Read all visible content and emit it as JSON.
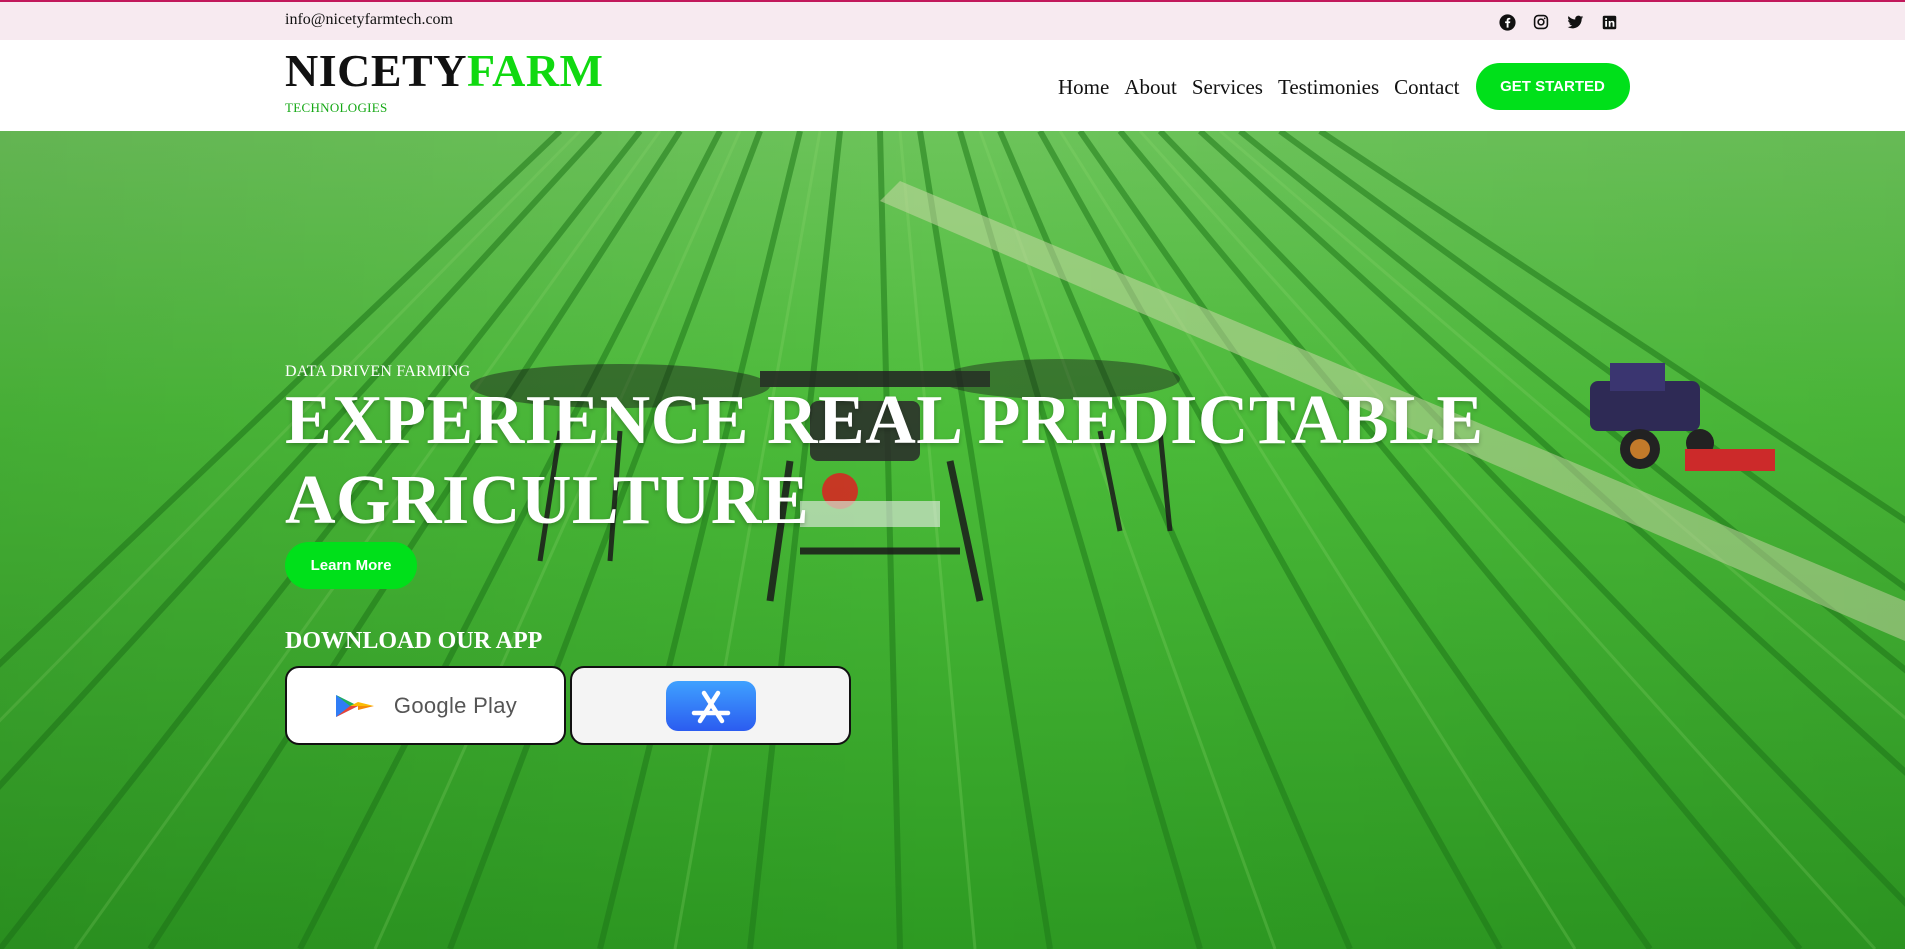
{
  "topbar": {
    "email": "info@nicetyfarmtech.com",
    "social": [
      "facebook-icon",
      "instagram-icon",
      "twitter-icon",
      "linkedin-icon"
    ]
  },
  "header": {
    "brand_part1": "NICETY",
    "brand_part2": "FARM",
    "brand_sub": "TECHNOLOGIES",
    "nav": [
      "Home",
      "About",
      "Services",
      "Testimonies",
      "Contact"
    ],
    "cta": "GET STARTED"
  },
  "hero": {
    "eyebrow": "DATA DRIVEN FARMING",
    "title": "EXPERIENCE REAL PREDICTABLE AGRICULTURE",
    "learn_more": "Learn More",
    "download_heading": "DOWNLOAD OUR APP",
    "google_play_label": "Google Play"
  },
  "colors": {
    "accent_green": "#00e01a",
    "brand_green": "#10d910",
    "topbar_bg": "#f7eaf0",
    "topbar_border": "#c2185b"
  }
}
